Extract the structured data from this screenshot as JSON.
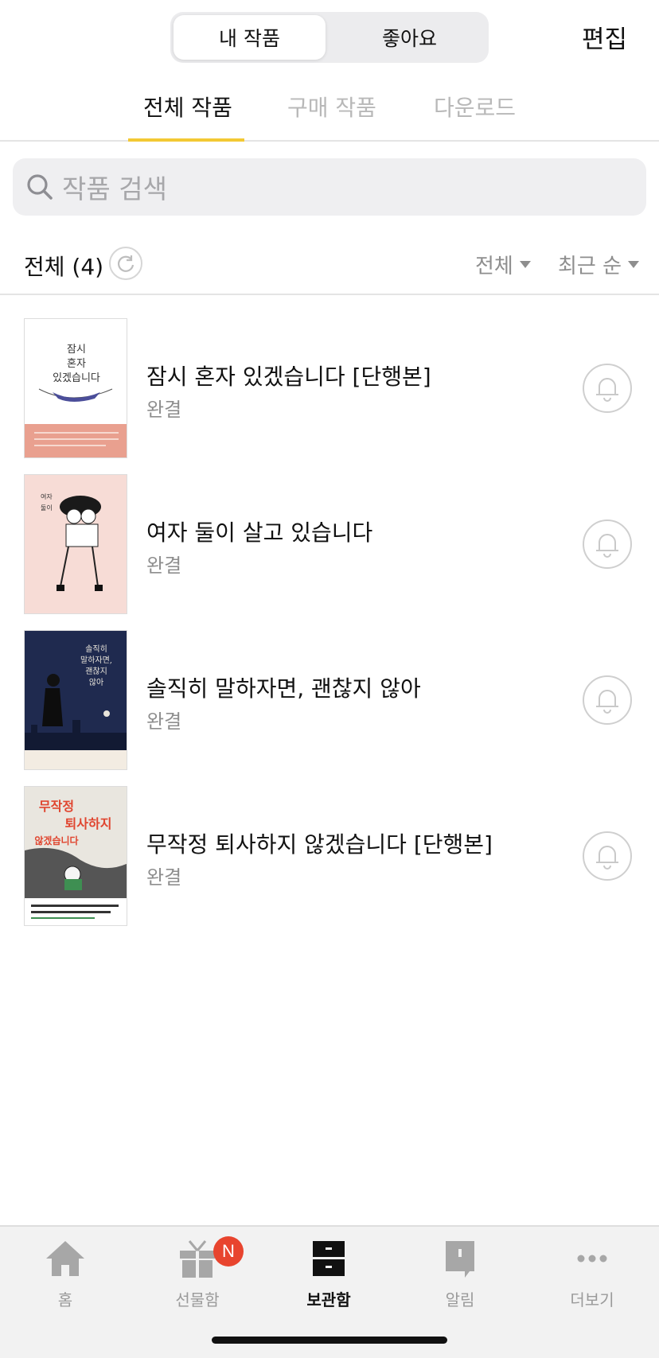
{
  "top_segment": {
    "my_works": "내 작품",
    "likes": "좋아요",
    "edit": "편집"
  },
  "sub_tabs": [
    {
      "label": "전체 작품"
    },
    {
      "label": "구매 작품"
    },
    {
      "label": "다운로드"
    }
  ],
  "search": {
    "placeholder": "작품 검색"
  },
  "list_header": {
    "count_label": "전체 (4)",
    "filter": "전체",
    "sort": "최근 순"
  },
  "books": [
    {
      "title": "잠시 혼자 있겠습니다 [단행본]",
      "status": "완결",
      "cover_text": "잠시\n혼자\n있겠습니다",
      "cover_top": "#ffffff",
      "cover_bottom": "#e9a08f"
    },
    {
      "title": "여자 둘이 살고 있습니다",
      "status": "완결",
      "cover_text": "여자 둘이 살고 있습니다",
      "cover_top": "#f7dcd6",
      "cover_bottom": "#f7dcd6"
    },
    {
      "title": "솔직히 말하자면, 괜찮지 않아",
      "status": "완결",
      "cover_text": "솔직히\n말하자면,\n괜찮지\n않아",
      "cover_top": "#1f2a4f",
      "cover_bottom": "#f3ece2"
    },
    {
      "title": "무작정 퇴사하지 않겠습니다 [단행본]",
      "status": "완결",
      "cover_text": "무작정\n퇴사하지\n않겠습니다",
      "cover_top": "#e9e6df",
      "cover_bottom": "#ffffff"
    }
  ],
  "bottom_nav": [
    {
      "label": "홈",
      "icon": "home-icon"
    },
    {
      "label": "선물함",
      "icon": "gift-icon",
      "badge": "N"
    },
    {
      "label": "보관함",
      "icon": "archive-icon",
      "active": true
    },
    {
      "label": "알림",
      "icon": "notification-icon"
    },
    {
      "label": "더보기",
      "icon": "more-icon"
    }
  ],
  "colors": {
    "accent": "#f3c934",
    "badge": "#e8442e"
  }
}
